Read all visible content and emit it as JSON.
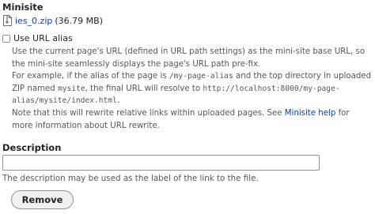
{
  "minisite": {
    "label": "Minisite",
    "file": {
      "name": "ies_0.zip",
      "size": "(36.79 MB)",
      "icon": "zip-file-icon"
    }
  },
  "url_alias": {
    "checkbox_label": "Use URL alias",
    "checked": false,
    "description": {
      "line1": "Use the current page's URL (defined in URL path settings) as the mini-site base URL, so the mini-site seamlessly displays the page's URL path pre-fix.",
      "example_prefix": "For example, if the alias of the page is ",
      "example_alias": "/my-page-alias",
      "example_mid1": " and the top directory in uploaded ZIP named ",
      "example_dir": "mysite",
      "example_mid2": ", the final URL will resolve to ",
      "example_url": "http://localhost:8000/my-page-alias/mysite/index.html",
      "example_end": ".",
      "note_prefix": "Note that this will rewrite relative links within uploaded pages. See ",
      "help_link": "Minisite help",
      "note_suffix": " for more information about URL rewrite."
    }
  },
  "description_field": {
    "label": "Description",
    "value": "",
    "help": "The description may be used as the label of the link to the file."
  },
  "remove_button": {
    "label": "Remove"
  }
}
